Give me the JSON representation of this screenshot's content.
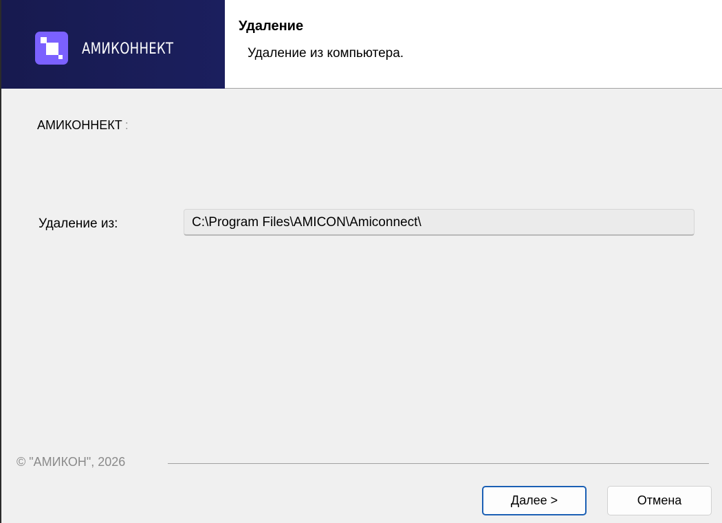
{
  "header": {
    "brand": "АМИКОННЕКТ",
    "title": "Удаление",
    "subtitle": "Удаление  из компьютера."
  },
  "body": {
    "product_label": "АМИКОННЕКТ",
    "product_colon": ":",
    "path_label": "Удаление из:",
    "path_value": "C:\\Program Files\\AMICON\\Amiconnect\\"
  },
  "footer": {
    "copyright": "© \"АМИКОН\", 2026",
    "next_label": "Далее >",
    "cancel_label": "Отмена"
  },
  "colors": {
    "banner": "#1a1d57",
    "logo": "#7b61ff",
    "primary_button_border": "#1a5fb4"
  },
  "icons": {
    "logo": "amiconnect-logo-icon"
  }
}
